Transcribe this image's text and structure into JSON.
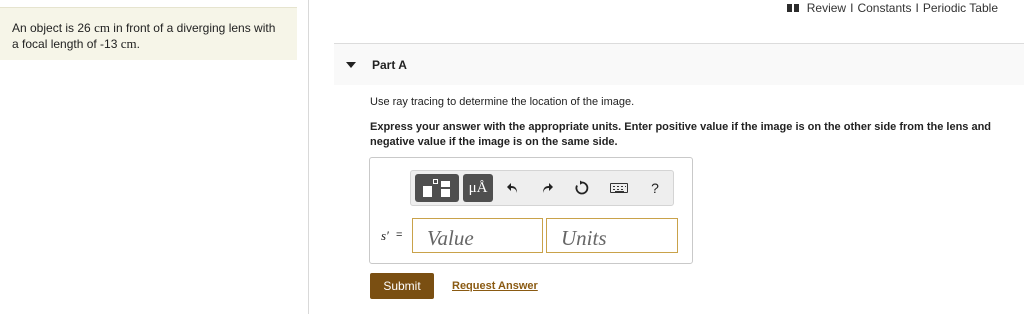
{
  "problem": {
    "text_before_distance": "An object is 26 ",
    "distance_unit": "cm",
    "text_middle": " in front of a diverging lens with a focal length of -13 ",
    "focal_unit": "cm",
    "text_end": "."
  },
  "top_links": {
    "review": "Review",
    "separator": "I",
    "constants": "Constants",
    "periodic_table": "Periodic Table"
  },
  "part": {
    "title": "Part A",
    "instruction": "Use ray tracing to determine the location of the image.",
    "directions": "Express your answer with the appropriate units. Enter positive value if the image is on the other side from the lens and negative value if the image is on the same side."
  },
  "answer": {
    "variable": "s′",
    "equals": "=",
    "value_placeholder": "Value",
    "units_placeholder": "Units",
    "toolbar": {
      "units_label": "μÅ",
      "help_label": "?",
      "icons": [
        "templates-icon",
        "units-icon",
        "undo-icon",
        "redo-icon",
        "reset-icon",
        "keyboard-icon",
        "help-icon"
      ]
    }
  },
  "actions": {
    "submit": "Submit",
    "request_answer": "Request Answer"
  },
  "colors": {
    "problem_background": "#f6f5e8",
    "toolbar_button": "#4f4f4f",
    "submit_background": "#7a4f12",
    "link": "#8a5a12",
    "input_border": "#c9a24a"
  }
}
